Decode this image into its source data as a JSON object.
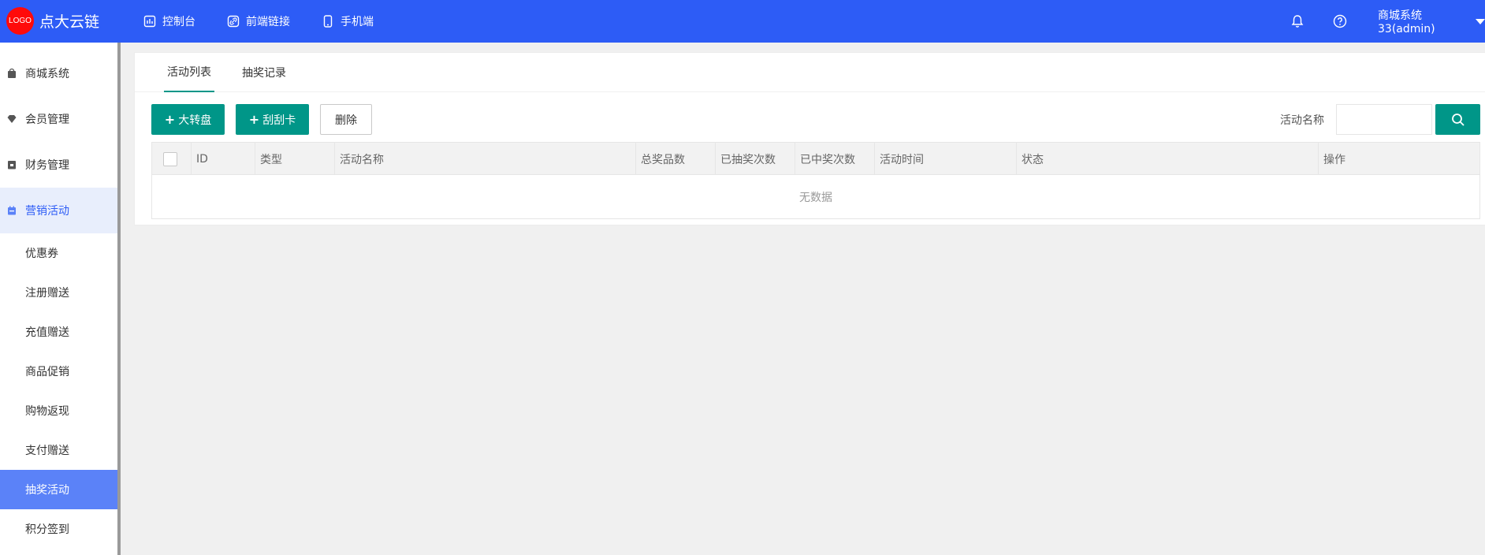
{
  "brand": {
    "logo": "LOGO",
    "name": "点大云链"
  },
  "topnav": [
    {
      "label": "控制台",
      "icon": "dashboard-icon"
    },
    {
      "label": "前端链接",
      "icon": "link-icon"
    },
    {
      "label": "手机端",
      "icon": "mobile-icon"
    }
  ],
  "user": {
    "name": "商城系统33(admin)"
  },
  "sidebar": {
    "main": [
      {
        "label": "商城系统",
        "icon": "shop-bag-icon"
      },
      {
        "label": "会员管理",
        "icon": "diamond-icon"
      },
      {
        "label": "财务管理",
        "icon": "wallet-icon"
      },
      {
        "label": "营销活动",
        "icon": "calendar-icon",
        "active": true
      }
    ],
    "sub": [
      {
        "label": "优惠券"
      },
      {
        "label": "注册赠送"
      },
      {
        "label": "充值赠送"
      },
      {
        "label": "商品促销"
      },
      {
        "label": "购物返现"
      },
      {
        "label": "支付赠送"
      },
      {
        "label": "抽奖活动",
        "active": true
      },
      {
        "label": "积分签到"
      }
    ]
  },
  "tabs": [
    {
      "label": "活动列表",
      "active": true
    },
    {
      "label": "抽奖记录"
    }
  ],
  "toolbar": {
    "wheel_label": "大转盘",
    "scratch_label": "刮刮卡",
    "delete_label": "删除",
    "search_label": "活动名称",
    "search_value": ""
  },
  "table": {
    "columns": [
      "ID",
      "类型",
      "活动名称",
      "总奖品数",
      "已抽奖次数",
      "已中奖次数",
      "活动时间",
      "状态",
      "操作"
    ],
    "empty_text": "无数据"
  },
  "colors": {
    "header_bg": "#2d5cf6",
    "logo_bg": "#ff0a0a",
    "primary_green": "#009688",
    "sidebar_active_bg": "#5b82f8"
  }
}
